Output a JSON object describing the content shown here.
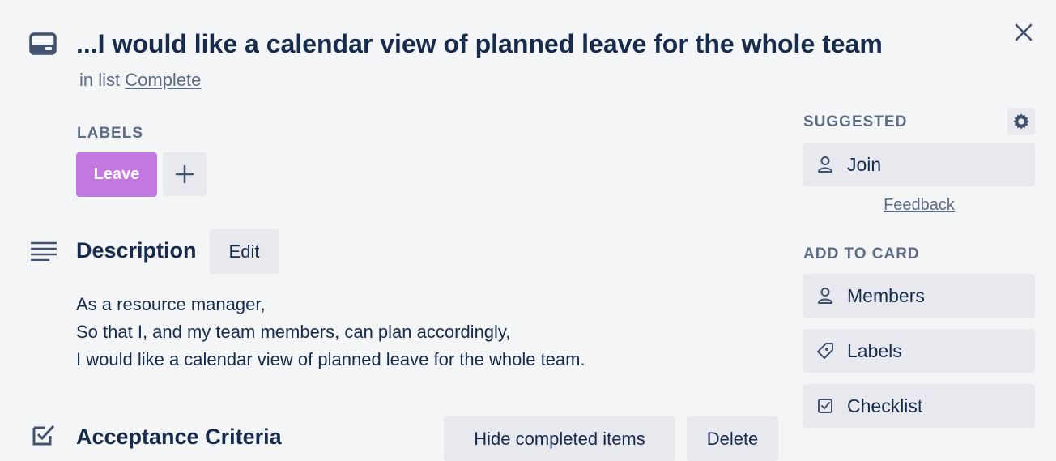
{
  "card": {
    "title": "...I would like a calendar view of planned leave for the whole team",
    "in_list_prefix": "in list",
    "list_name": "Complete"
  },
  "labels": {
    "heading": "LABELS",
    "items": [
      {
        "text": "Leave",
        "color": "#c377e0"
      }
    ]
  },
  "description": {
    "heading": "Description",
    "edit_label": "Edit",
    "lines": [
      "As a resource manager,",
      "So that I, and my team members, can plan accordingly,",
      "I would like a calendar view of planned leave for the whole team."
    ]
  },
  "acceptance": {
    "heading": "Acceptance Criteria",
    "hide_label": "Hide completed items",
    "delete_label": "Delete"
  },
  "sidebar": {
    "suggested_heading": "SUGGESTED",
    "join_label": "Join",
    "feedback_label": "Feedback",
    "add_heading": "ADD TO CARD",
    "members_label": "Members",
    "labels_label": "Labels",
    "checklist_label": "Checklist"
  },
  "icons": {
    "card": "card-icon",
    "close": "close-icon",
    "plus": "plus-icon",
    "description": "description-icon",
    "checklist": "checklist-icon",
    "gear": "gear-icon",
    "member": "person-icon",
    "label": "tag-icon"
  }
}
